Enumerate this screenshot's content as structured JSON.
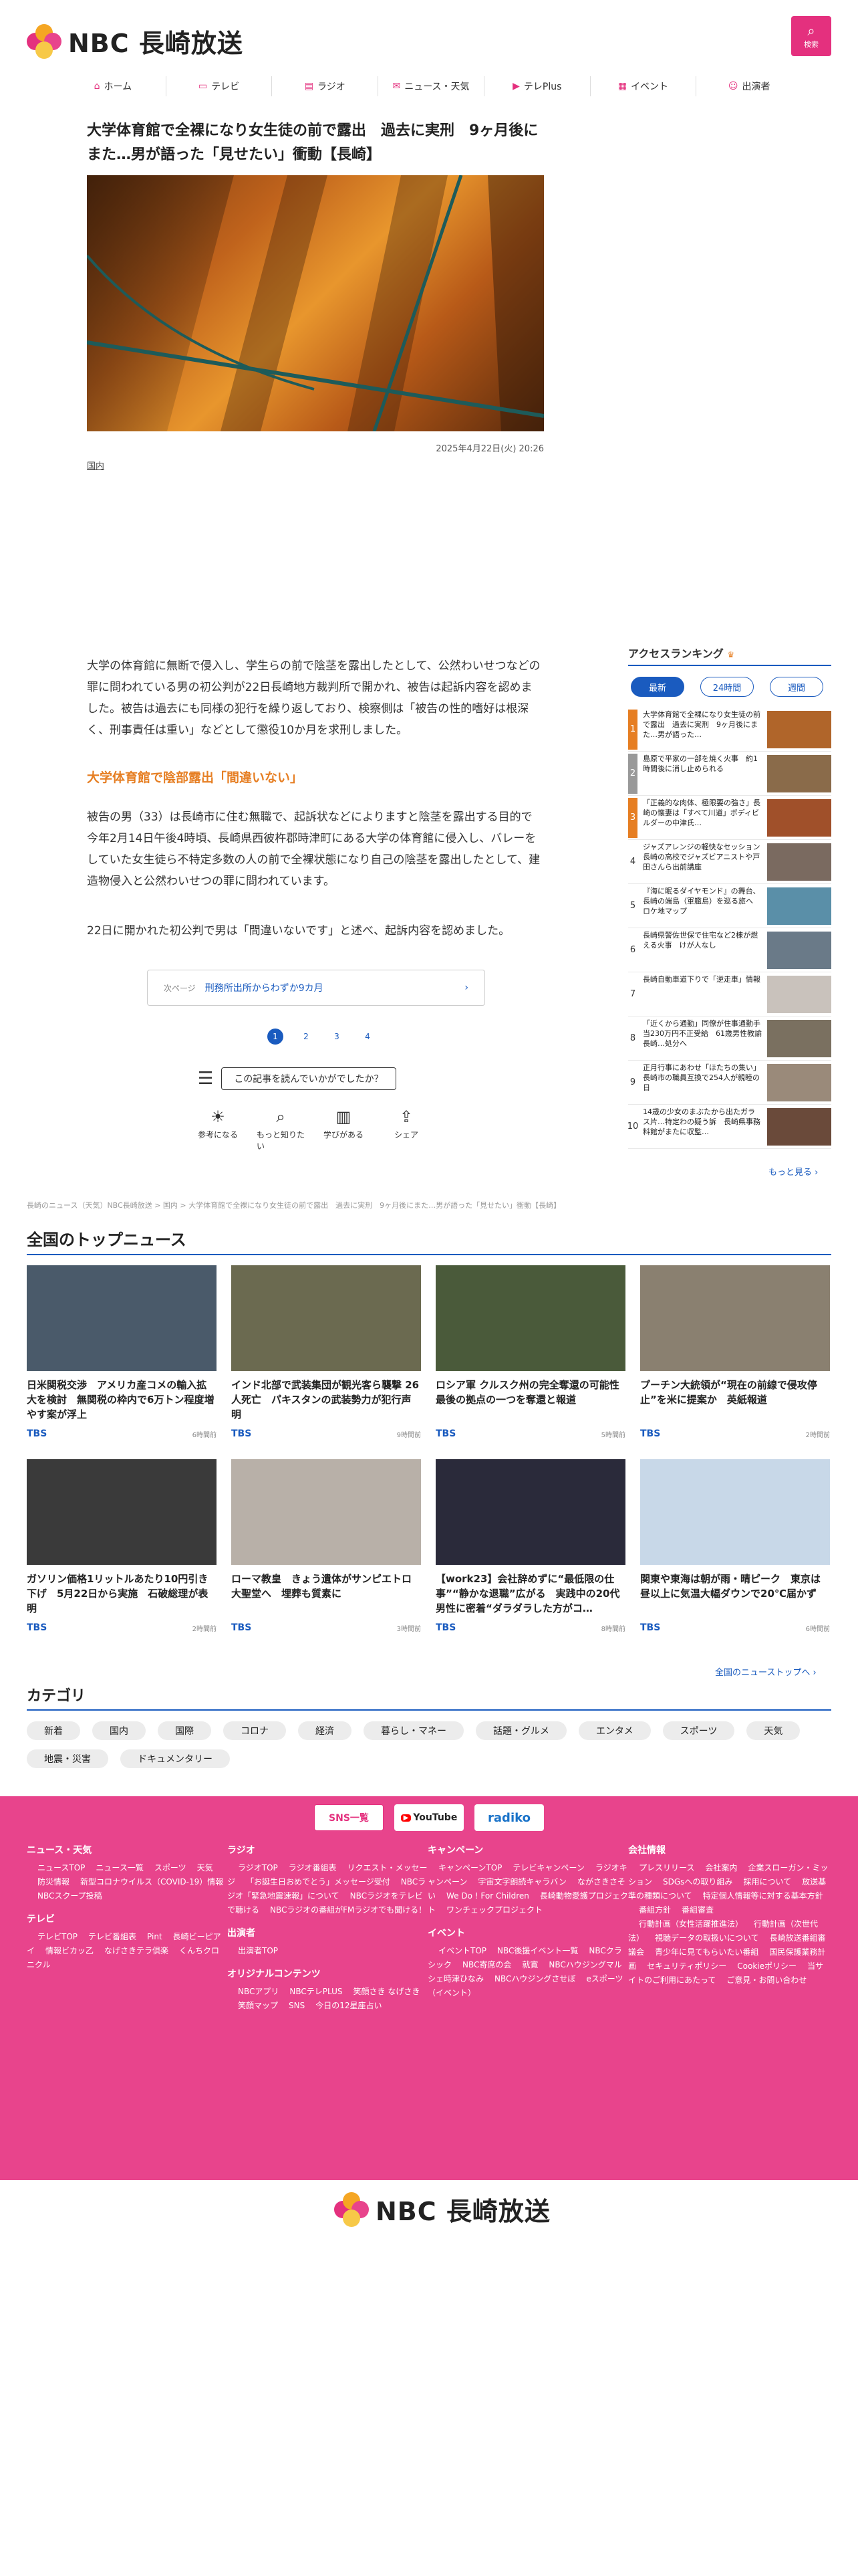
{
  "header": {
    "logo_text": "NBC 長崎放送",
    "search_label": "検索",
    "nav": [
      {
        "label": "ホーム",
        "icon": "home-icon"
      },
      {
        "label": "テレビ",
        "icon": "tv-icon"
      },
      {
        "label": "ラジオ",
        "icon": "radio-icon"
      },
      {
        "label": "ニュース・天気",
        "icon": "news-icon"
      },
      {
        "label": "テレPlus",
        "icon": "play-icon"
      },
      {
        "label": "イベント",
        "icon": "calendar-icon"
      },
      {
        "label": "出演者",
        "icon": "people-icon"
      }
    ]
  },
  "article": {
    "title": "大学体育館で全裸になり女生徒の前で露出　過去に実刑　9ヶ月後にまた…男が語った「見せたい」衝動【長崎】",
    "date": "2025年4月22日(火) 20:26",
    "category": "国内",
    "para1": "大学の体育館に無断で侵入し、学生らの前で陰茎を露出したとして、公然わいせつなどの罪に問われている男の初公判が22日長崎地方裁判所で開かれ、被告は起訴内容を認めました。被告は過去にも同様の犯行を繰り返しており、検察側は「被告の性的嗜好は根深く、刑事責任は重い」などとして懲役10か月を求刑しました。",
    "subhead": "大学体育館で陰部露出「間違いない」",
    "para2": "被告の男（33）は長崎市に住む無職で、起訴状などによりますと陰茎を露出する目的で今年2月14日午後4時頃、長崎県西彼杵郡時津町にある大学の体育館に侵入し、バレーをしていた女生徒ら不特定多数の人の前で全裸状態になり自己の陰茎を露出したとして、建造物侵入と公然わいせつの罪に問われています。",
    "para3": "22日に開かれた初公判で男は「間違いないです」と述べ、起訴内容を認めました。",
    "next_prefix": "次ページ",
    "next_label": "刑務所出所からわずか9カ月",
    "pages": [
      "1",
      "2",
      "3",
      "4"
    ],
    "feedback_q": "この記事を読んでいかがでしたか？",
    "reactions": [
      {
        "label": "参考になる",
        "icon": "bulb-icon"
      },
      {
        "label": "もっと知りたい",
        "icon": "magnifier-icon"
      },
      {
        "label": "学びがある",
        "icon": "book-icon"
      },
      {
        "label": "シェア",
        "icon": "share-icon"
      }
    ]
  },
  "ranking": {
    "title": "アクセスランキング",
    "tabs": [
      "最新",
      "24時間",
      "週間"
    ],
    "items": [
      {
        "rank": "1",
        "text": "大学体育館で全裸になり女生徒の前で露出　過去に実刑　9ヶ月後にまた…男が語った…"
      },
      {
        "rank": "2",
        "text": "島原で平家の一部を焼く火事　約1時間後に消し止められる"
      },
      {
        "rank": "3",
        "text": "「正義的な肉体、極限要の強さ」長崎の懐妻は「すべて川道」ボディビルダーの中津氏…"
      },
      {
        "rank": "4",
        "text": "ジャズアレンジの軽快なセッション長崎の高校でジャズビアニストや戸田さんら出前講座"
      },
      {
        "rank": "5",
        "text": "『海に眠るダイヤモンド』の舞台、長崎の端島（軍艦島）を巡る旅へ ロケ地マップ"
      },
      {
        "rank": "6",
        "text": "長崎県警佐世保で住宅など2棟が燃える火事　けが人なし"
      },
      {
        "rank": "7",
        "text": "長崎自動車道下りで「逆走車」情報"
      },
      {
        "rank": "8",
        "text": "「近くから通勤」同僚が住事通勤手当230万円不正受給　61歳男性教諭　長崎…処分へ"
      },
      {
        "rank": "9",
        "text": "正月行事にあわせ「ほたちの集い」長崎市の職員互換で254人が親睦の日"
      },
      {
        "rank": "10",
        "text": "14歳の少女のまぶたから出たガラス片…特定わの疑う訴　長崎県事務料館がまたに収監…"
      }
    ],
    "more": "もっと見る"
  },
  "breadcrumb": "長崎のニュース（天気）NBC長崎放送 > 国内 > 大学体育館で全裸になり女生徒の前で露出　過去に実刑　9ヶ月後にまた…男が語った「見せたい」衝動【長崎】",
  "topnews": {
    "title": "全国のトップニュース",
    "items": [
      {
        "title": "日米関税交渉　アメリカ産コメの輸入拡大を検討　無関税の枠内で6万トン程度増やす案が浮上",
        "source": "TBS",
        "time": "6時間前"
      },
      {
        "title": "インド北部で武装集団が観光客ら襲撃 26人死亡　パキスタンの武装勢力が犯行声明",
        "source": "TBS",
        "time": "9時間前"
      },
      {
        "title": "ロシア軍 クルスク州の完全奪還の可能性　最後の拠点の一つを奪還と報道",
        "source": "TBS",
        "time": "5時間前"
      },
      {
        "title": "プーチン大統領が“現在の前線で侵攻停止”を米に提案か　英紙報道",
        "source": "TBS",
        "time": "2時間前"
      },
      {
        "title": "ガソリン価格1リットルあたり10円引き下げ　5月22日から実施　石破総理が表明",
        "source": "TBS",
        "time": "2時間前"
      },
      {
        "title": "ローマ教皇　きょう遺体がサンピエトロ大聖堂へ　埋葬も質素に",
        "source": "TBS",
        "time": "3時間前"
      },
      {
        "title": "【work23】会社辞めずに“最低限の仕事”“静かな退職”広がる　実践中の20代男性に密着“ダラダラした方がコ…",
        "source": "TBS",
        "time": "8時間前"
      },
      {
        "title": "関東や東海は朝が雨・晴ピーク　東京は昼以上に気温大幅ダウンで20℃届かず",
        "source": "TBS",
        "time": "6時間前"
      }
    ],
    "more": "全国のニューストップへ"
  },
  "categories": {
    "title": "カテゴリ",
    "items": [
      "新着",
      "国内",
      "国際",
      "コロナ",
      "経済",
      "暮らし・マネー",
      "話題・グルメ",
      "エンタメ",
      "スポーツ",
      "天気",
      "地震・災害",
      "ドキュメンタリー"
    ]
  },
  "footer": {
    "buttons": [
      "SNS一覧",
      "YouTube",
      "radiko"
    ],
    "cols": [
      [
        {
          "head": "ニュース・天気",
          "links": [
            "ニュースTOP",
            "ニュース一覧",
            "スポーツ",
            "天気",
            "防災情報",
            "新型コロナウイルス（COVID-19）情報",
            "NBCスクープ投稿"
          ]
        },
        {
          "head": "テレビ",
          "links": [
            "テレビTOP",
            "テレビ番組表",
            "Pint",
            "長崎ビーピアイ",
            "情報ビカッ乙",
            "なげさきテラ倶楽",
            "くんちクロニクル"
          ]
        }
      ],
      [
        {
          "head": "ラジオ",
          "links": [
            "ラジオTOP",
            "ラジオ番組表",
            "リクエスト・メッセージ",
            "「お誕生日おめでとう」メッセージ受付",
            "NBCラジオ「緊急地震速報」について",
            "NBCラジオをテレビで聴ける",
            "NBCラジオの番組がFMラジオでも聞ける！"
          ]
        },
        {
          "head": "出演者",
          "links": [
            "出演者TOP"
          ]
        },
        {
          "head": "オリジナルコンテンツ",
          "links": [
            "NBCアプリ",
            "NBCテレPLUS",
            "笑顔さき なげさき",
            "笑顔マップ",
            "SNS",
            "今日の12星座占い"
          ]
        }
      ],
      [
        {
          "head": "キャンペーン",
          "links": [
            "キャンペーンTOP",
            "テレビキャンペーン",
            "ラジオキャンペーン",
            "宇宙文字朗読キャラバン",
            "ながさきさそい",
            "We Do ! For Children",
            "長崎動物愛護プロジェクト",
            "ワンチェックプロジェクト"
          ]
        },
        {
          "head": "イベント",
          "links": [
            "イベントTOP",
            "NBC後援イベント一覧",
            "NBCクラシック",
            "NBC寄席の会",
            "就寛",
            "NBCハウジングマルシェ時津ひなみ",
            "NBCハウジングさせぼ",
            "eスポーツ（イベント）"
          ]
        }
      ],
      [
        {
          "head": "会社情報",
          "links": [
            "プレスリリース",
            "会社案内",
            "企業スローガン・ミッション",
            "SDGsへの取り組み",
            "採用について",
            "放送基準の種類について",
            "特定個人情報等に対する基本方針",
            "番組方針",
            "番組審査",
            "行動計画（女性活躍推進法）",
            "行動計画（次世代法）",
            "視聴データの取扱いについて",
            "長崎放送番組審議会",
            "青少年に見てもらいたい番組",
            "国民保護業務計画",
            "セキュリティポリシー",
            "Cookieポリシー",
            "当サイトのご利用にあたって",
            "ご意見・お問い合わせ"
          ]
        }
      ]
    ],
    "logo_text": "NBC 長崎放送"
  },
  "colors": {
    "accent": "#e4307e",
    "link": "#1a5bbf",
    "footer_bg": "#e8448c",
    "subhead": "#e67e22"
  }
}
